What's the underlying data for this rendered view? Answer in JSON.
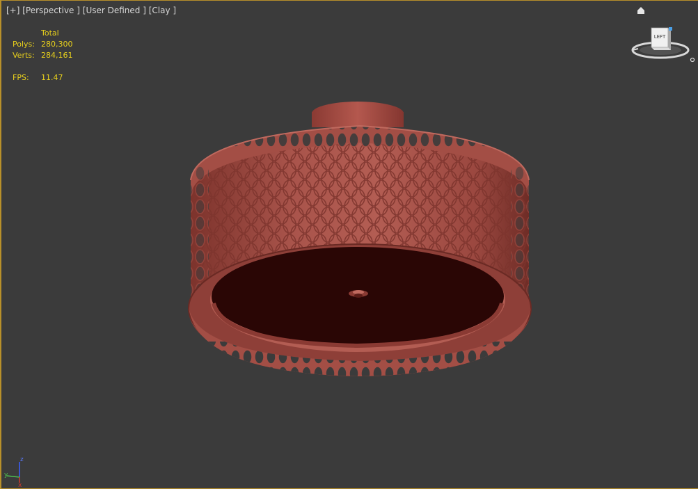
{
  "viewport": {
    "label_parts": [
      "[+]",
      "[Perspective ]",
      "[User Defined ]",
      "[Clay ]"
    ]
  },
  "stats": {
    "header": "Total",
    "polys_label": "Polys:",
    "polys_value": "280,300",
    "verts_label": "Verts:",
    "verts_value": "284,161",
    "fps_label": "FPS:",
    "fps_value": "11.47"
  },
  "viewcube": {
    "face_label": "LEFT"
  },
  "axis_gizmo": {
    "z": "z",
    "y": "y",
    "x": "x"
  },
  "colors": {
    "background": "#3b3b3b",
    "stats_text": "#e9d11c",
    "model_base": "#9c4a42",
    "model_inner": "#2a0605",
    "viewport_border": "#b8902a"
  }
}
